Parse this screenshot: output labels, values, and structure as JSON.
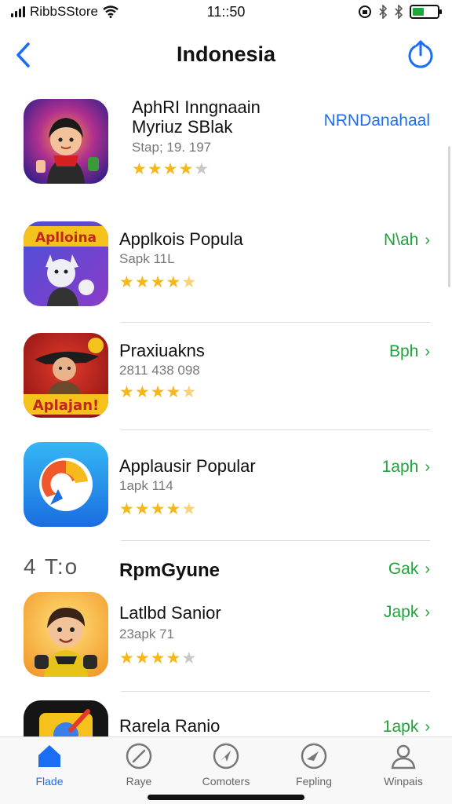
{
  "status": {
    "carrier": "RibbSStore",
    "time": "11::50"
  },
  "nav": {
    "title": "Indonesia"
  },
  "apps": [
    {
      "name_line1": "AphRI Inngnaain",
      "name_line2": "Myriuz SBlak",
      "subtitle": "Stap; 19. 197",
      "rating": 4,
      "action": "NRNDanahaal",
      "icon": "superhero-girl-app-icon"
    },
    {
      "name": "Applkois Popula",
      "subtitle": "Sapk 11L",
      "rating": 4.5,
      "action": "N\\ah",
      "icon": "cat-cartoon-app-icon",
      "icon_text": "Aplloina"
    },
    {
      "name": "Praxiuakns",
      "subtitle": "2811 438 098",
      "rating": 4.5,
      "action": "Bph",
      "icon": "cowboy-cartoon-app-icon",
      "icon_text": "Aplajan!"
    },
    {
      "name": "Applausir Popular",
      "subtitle": "1apk 114",
      "rating": 4.5,
      "action": "1aph",
      "icon": "swirl-logo-app-icon"
    },
    {
      "name": "Latlbd Sanior",
      "subtitle": "23apk 71",
      "rating": 4,
      "action": "Japk",
      "icon": "boy-cartoon-app-icon"
    },
    {
      "name": "Rarela Ranio",
      "subtitle": "",
      "rating": 0,
      "action": "1apk",
      "icon": "pencil-app-icon"
    }
  ],
  "section": {
    "number": "4 T:o",
    "title": "RpmGyune",
    "action": "Gak"
  },
  "tabs": [
    {
      "label": "Flade",
      "icon": "home-icon",
      "active": true
    },
    {
      "label": "Raye",
      "icon": "compass-icon",
      "active": false
    },
    {
      "label": "Comoters",
      "icon": "navigation-icon",
      "active": false
    },
    {
      "label": "Fepling",
      "icon": "gauge-icon",
      "active": false
    },
    {
      "label": "Winpais",
      "icon": "person-icon",
      "active": false
    }
  ],
  "colors": {
    "accent_blue": "#1b6ef3",
    "action_green": "#1fa33a",
    "star": "#f5b71b"
  }
}
